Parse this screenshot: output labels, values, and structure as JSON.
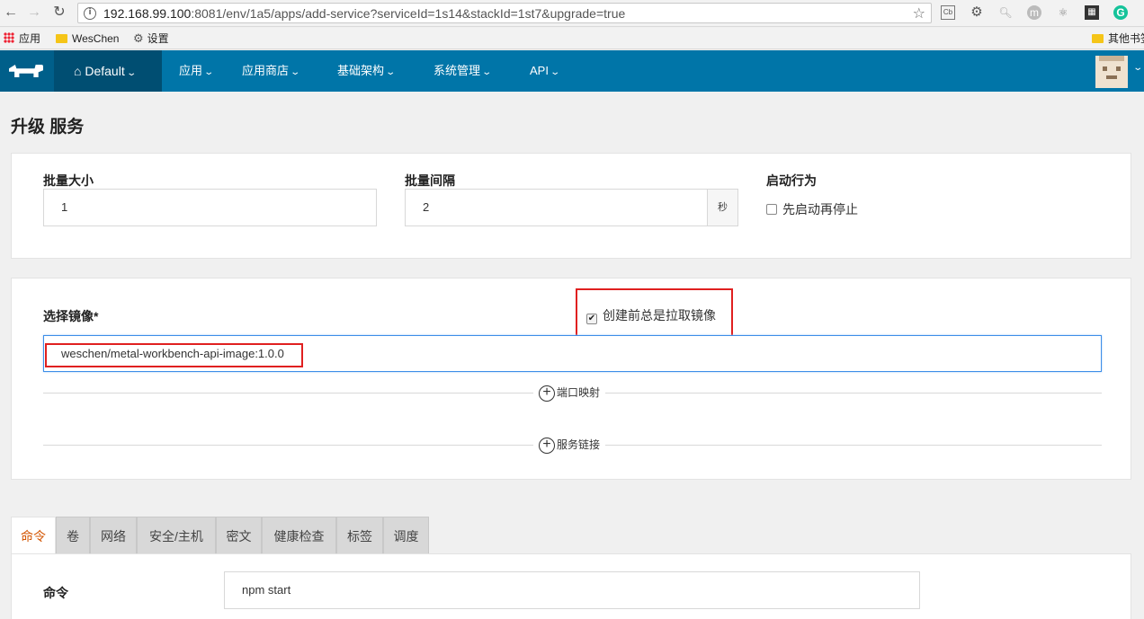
{
  "browser": {
    "url_host": "192.168.99.100",
    "url_rest": ":8081/env/1a5/apps/add-service?serviceId=1s14&stackId=1st7&upgrade=true",
    "info_glyph": "i",
    "ext_cb": "Cb",
    "ext_m": "m",
    "ext_g": "G"
  },
  "bookmarks": {
    "apps": "应用",
    "weschen": "WesChen",
    "settings": "设置",
    "other": "其他书签"
  },
  "header": {
    "env": "Default",
    "nav": [
      "应用",
      "应用商店",
      "基础架构",
      "系统管理",
      "API"
    ]
  },
  "page": {
    "title": "升级 服务"
  },
  "upgrade": {
    "batch_size_label": "批量大小",
    "batch_size_value": "1",
    "batch_interval_label": "批量间隔",
    "batch_interval_value": "2",
    "interval_unit": "秒",
    "start_behavior_label": "启动行为",
    "start_first_label": "先启动再停止",
    "start_first_checked": false
  },
  "image": {
    "label": "选择镜像*",
    "pull_label": "创建前总是拉取镜像",
    "pull_checked": true,
    "value": "weschen/metal-workbench-api-image:1.0.0",
    "port_map_label": "端口映射",
    "service_link_label": "服务链接"
  },
  "tabs": [
    "命令",
    "卷",
    "网络",
    "安全/主机",
    "密文",
    "健康检查",
    "标签",
    "调度"
  ],
  "active_tab": 0,
  "command": {
    "label": "命令",
    "value": "npm start"
  },
  "colors": {
    "nav_bg": "#0075a8",
    "env_bg": "#004e72",
    "active_tab": "#d35400",
    "highlight": "#e02020"
  }
}
